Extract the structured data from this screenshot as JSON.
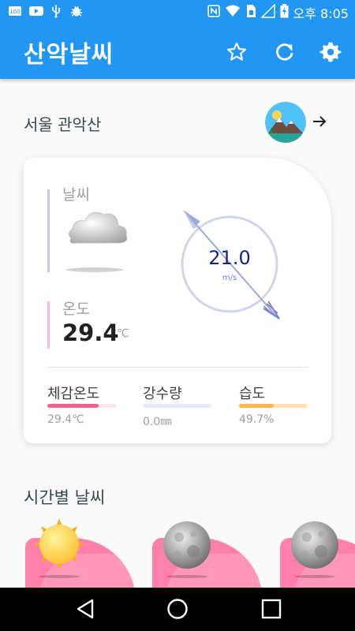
{
  "status_bar": {
    "time": "오후 8:05",
    "left_icons": [
      "notification-100-icon",
      "youtube-icon",
      "usb-icon",
      "bug-icon"
    ],
    "right_icons": [
      "nfc-icon",
      "wifi-icon",
      "sim-icon",
      "signal-icon",
      "battery-charging-icon"
    ]
  },
  "app_bar": {
    "title": "산악날씨",
    "actions": [
      "star-icon",
      "refresh-icon",
      "settings-icon"
    ]
  },
  "location": {
    "name": "서울 관악산"
  },
  "current": {
    "weather_label": "날씨",
    "weather_icon": "cloudy-icon",
    "temp_label": "온도",
    "temp_value": "29.4",
    "temp_unit": "℃",
    "wind_value": "21.0",
    "wind_unit": "m/s",
    "stats": [
      {
        "label": "체감온도",
        "value": "29.4℃",
        "level": 0.75,
        "color": "#f06292",
        "track": "#fce4ec"
      },
      {
        "label": "강수량",
        "value": "0.0㎜",
        "level": 0.0,
        "color": "#9fa8da",
        "track": "#e8eaf6"
      },
      {
        "label": "습도",
        "value": "49.7%",
        "level": 0.5,
        "color": "#ffb74d",
        "track": "#ffe0b2"
      }
    ]
  },
  "hourly": {
    "title": "시간별 날씨",
    "items": [
      {
        "icon": "sun-icon"
      },
      {
        "icon": "moon-icon"
      },
      {
        "icon": "moon-icon"
      }
    ]
  },
  "colors": {
    "primary": "#2196f3",
    "card_accent": "#ff80ab",
    "wind_ring": "#c5cae9",
    "wind_text": "#1a237e"
  },
  "nav_bar": [
    "back-icon",
    "home-icon",
    "recents-icon"
  ]
}
